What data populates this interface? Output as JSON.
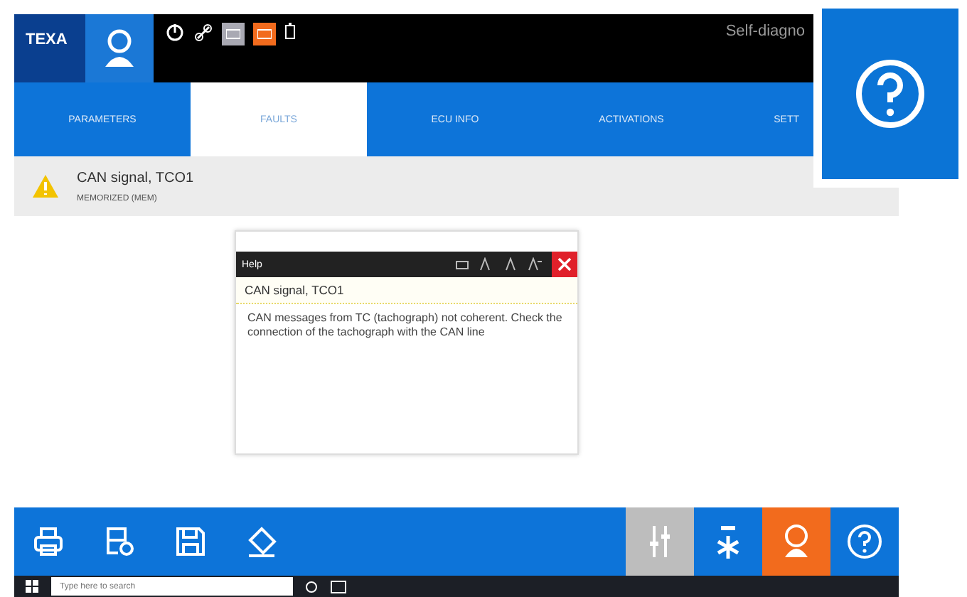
{
  "header": {
    "logo": "TEXA",
    "title": "Self-diagno"
  },
  "tabs": [
    {
      "label": "PARAMETERS",
      "selected": false
    },
    {
      "label": "FAULTS",
      "selected": true
    },
    {
      "label": "ECU INFO",
      "selected": false
    },
    {
      "label": "ACTIVATIONS",
      "selected": false
    },
    {
      "label": "SETT",
      "selected": false
    }
  ],
  "fault": {
    "name": "CAN signal, TCO1",
    "status": "MEMORIZED (MEM)"
  },
  "help_dialog": {
    "title": "Help",
    "heading": "CAN signal, TCO1",
    "body": "CAN messages from TC (tachograph) not coherent. Check the connection of the tachograph with the CAN line"
  },
  "taskbar": {
    "search": {
      "placeholder": "Type here to search"
    }
  }
}
